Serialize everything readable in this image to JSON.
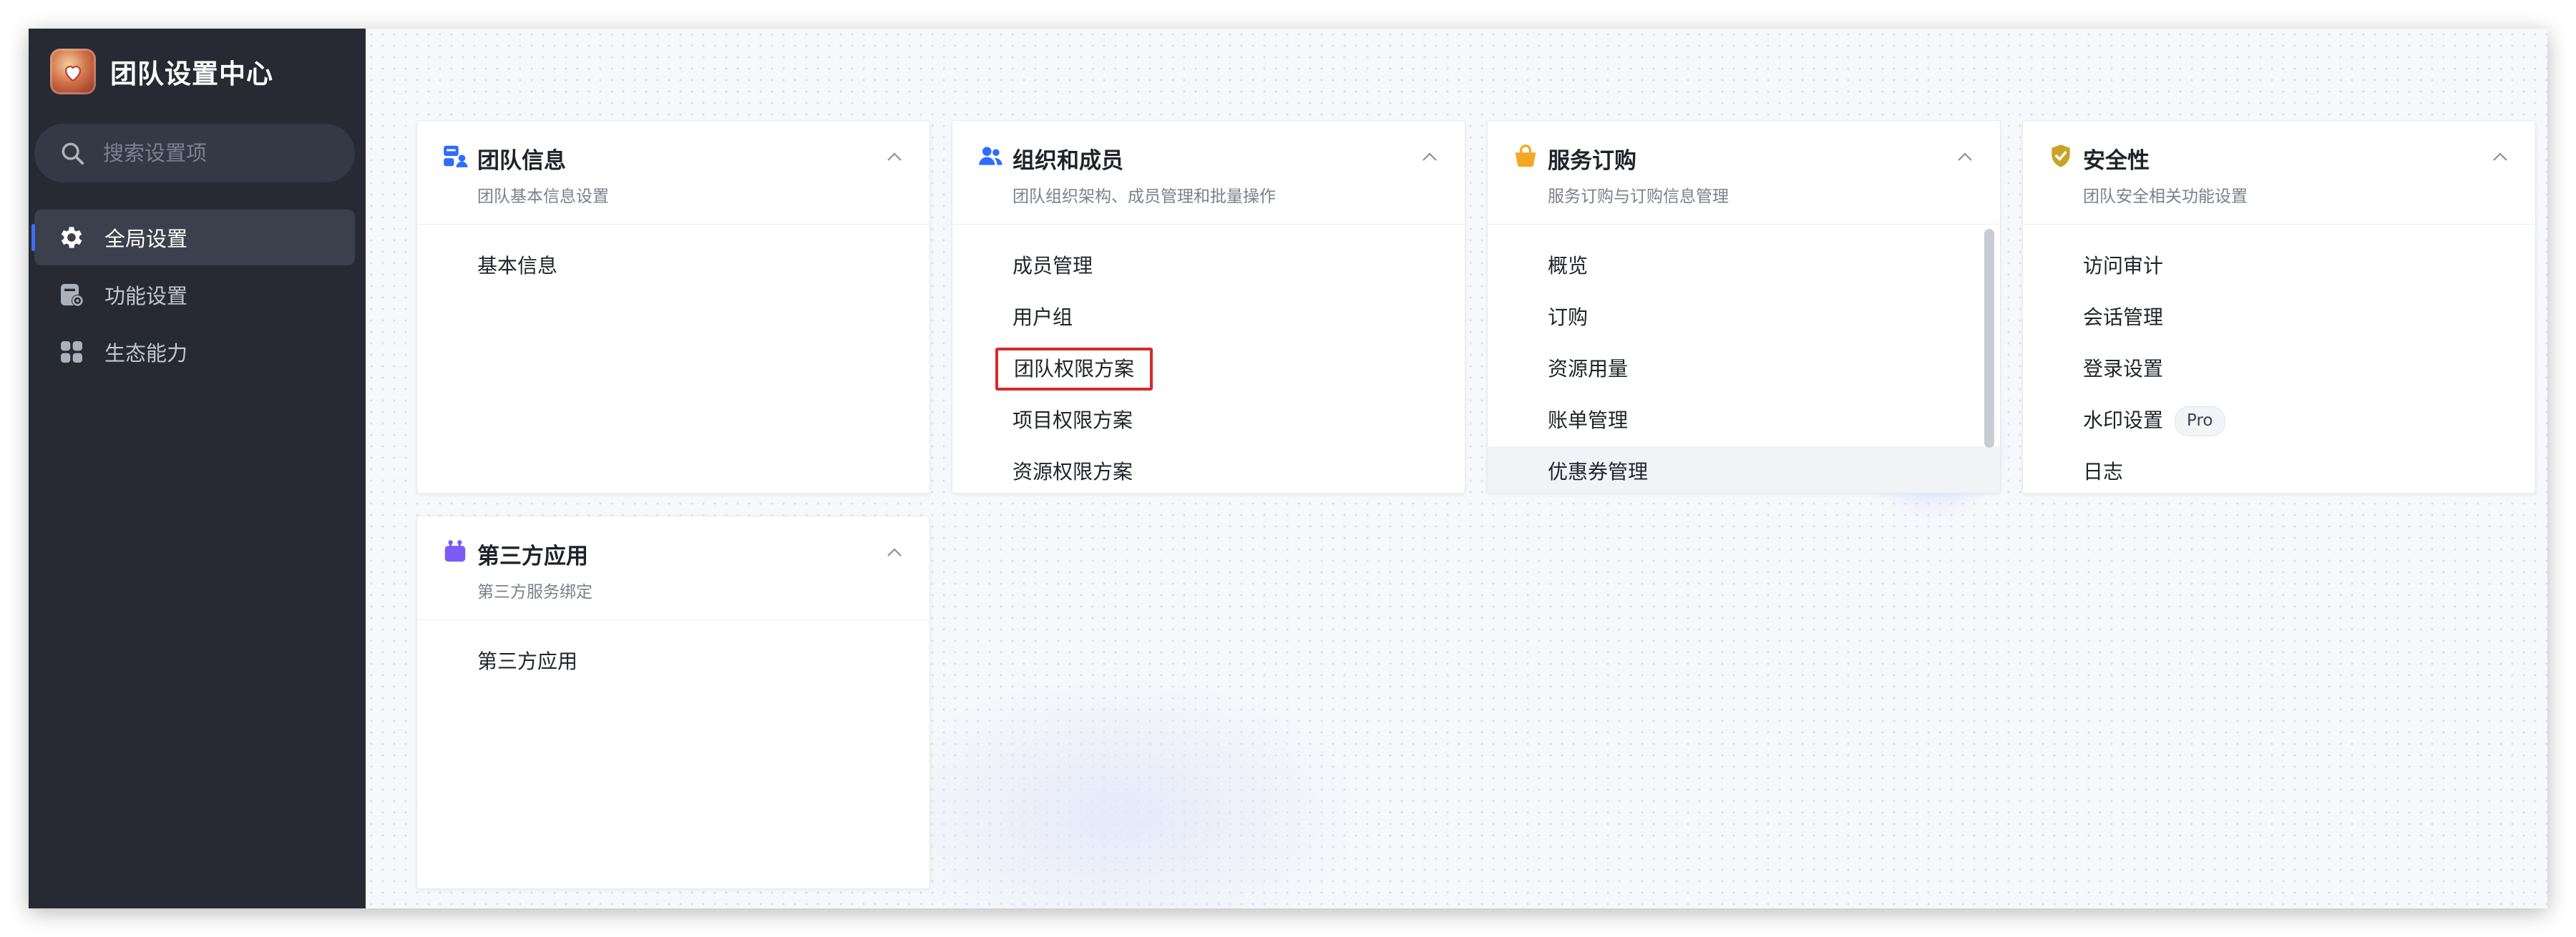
{
  "app": {
    "title": "团队设置中心"
  },
  "search": {
    "placeholder": "搜索设置项"
  },
  "sidebar": {
    "items": [
      {
        "label": "全局设置",
        "icon": "gear-icon",
        "active": true
      },
      {
        "label": "功能设置",
        "icon": "feature-settings-icon",
        "active": false
      },
      {
        "label": "生态能力",
        "icon": "apps-grid-icon",
        "active": false
      }
    ]
  },
  "cards": {
    "team_info": {
      "title": "团队信息",
      "subtitle": "团队基本信息设置",
      "icon": "team-info-icon",
      "items": [
        "基本信息"
      ]
    },
    "org_members": {
      "title": "组织和成员",
      "subtitle": "团队组织架构、成员管理和批量操作",
      "icon": "members-icon",
      "items": [
        "成员管理",
        "用户组",
        "团队权限方案",
        "项目权限方案",
        "资源权限方案"
      ]
    },
    "service": {
      "title": "服务订购",
      "subtitle": "服务订购与订购信息管理",
      "icon": "shopping-bag-icon",
      "items": [
        "概览",
        "订购",
        "资源用量",
        "账单管理",
        "优惠券管理"
      ]
    },
    "security": {
      "title": "安全性",
      "subtitle": "团队安全相关功能设置",
      "icon": "shield-check-icon",
      "items": [
        "访问审计",
        "会话管理",
        "登录设置",
        "水印设置",
        "日志"
      ],
      "badge": "Pro"
    },
    "third_party": {
      "title": "第三方应用",
      "subtitle": "第三方服务绑定",
      "icon": "third-party-app-icon",
      "items": [
        "第三方应用"
      ]
    }
  },
  "colors": {
    "sidebar_bg": "#272a33",
    "accent": "#3b6ff5",
    "highlight_border": "#d42a2a",
    "service_icon": "#f5a623",
    "security_icon": "#c9a227",
    "third_party_icon": "#7b5cf5"
  }
}
